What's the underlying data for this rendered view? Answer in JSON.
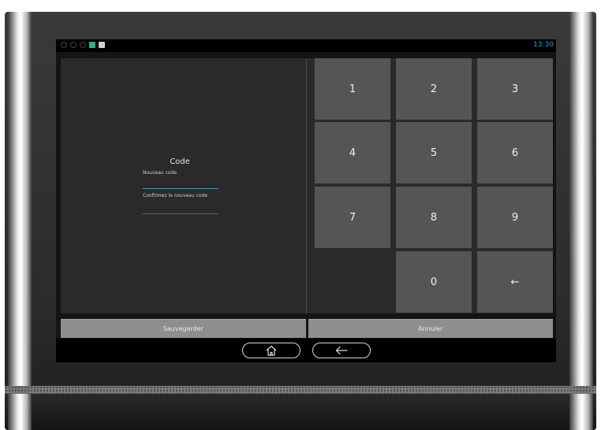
{
  "status_bar": {
    "time": "13:30",
    "accent_color": "#1fa3d9"
  },
  "form": {
    "title": "Code",
    "new_code_label": "Nouveau code",
    "new_code_value": "",
    "confirm_code_label": "Confirmez le nouveau code",
    "confirm_code_value": ""
  },
  "keypad": {
    "keys": [
      "1",
      "2",
      "3",
      "4",
      "5",
      "6",
      "7",
      "8",
      "9",
      "0",
      "←"
    ],
    "backspace_icon": "backspace-arrow-icon"
  },
  "actions": {
    "save_label": "Sauvegarder",
    "cancel_label": "Annuler"
  },
  "nav": {
    "home_icon": "home-icon",
    "back_icon": "back-arrow-icon"
  }
}
